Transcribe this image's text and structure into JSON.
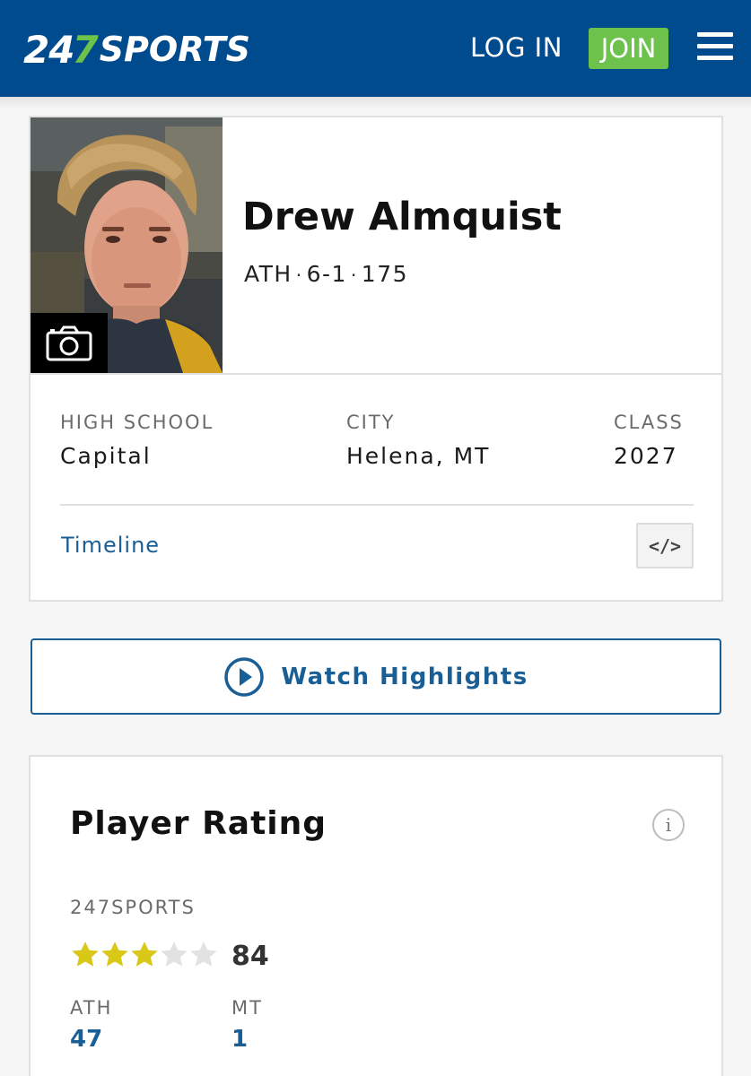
{
  "header": {
    "logo_part1": "24",
    "logo_part2": "7",
    "logo_part3": "SPORTS",
    "login_label": "LOG IN",
    "join_label": "JOIN",
    "menu_icon": "hamburger-menu-icon",
    "brand_color": "#004a8e",
    "accent_color": "#6cc24a"
  },
  "profile": {
    "photo_icon": "camera-icon",
    "name": "Drew Almquist",
    "position": "ATH",
    "separator": "·",
    "height": "6-1",
    "weight": "175",
    "info": [
      {
        "label": "HIGH SCHOOL",
        "value": "Capital"
      },
      {
        "label": "CITY",
        "value": "Helena, MT"
      },
      {
        "label": "CLASS",
        "value": "2027"
      }
    ],
    "timeline_label": "Timeline",
    "embed_label": "</>"
  },
  "highlights": {
    "label": "Watch Highlights",
    "icon": "play-circle-icon"
  },
  "rating": {
    "title": "Player Rating",
    "info_label": "i",
    "source": "247SPORTS",
    "stars_filled": 3,
    "stars_total": 5,
    "score": "84",
    "ranks": [
      {
        "label": "ATH",
        "value": "47"
      },
      {
        "label": "MT",
        "value": "1"
      }
    ],
    "star_color": "#d9c818",
    "star_empty_color": "#e2e2e2"
  }
}
